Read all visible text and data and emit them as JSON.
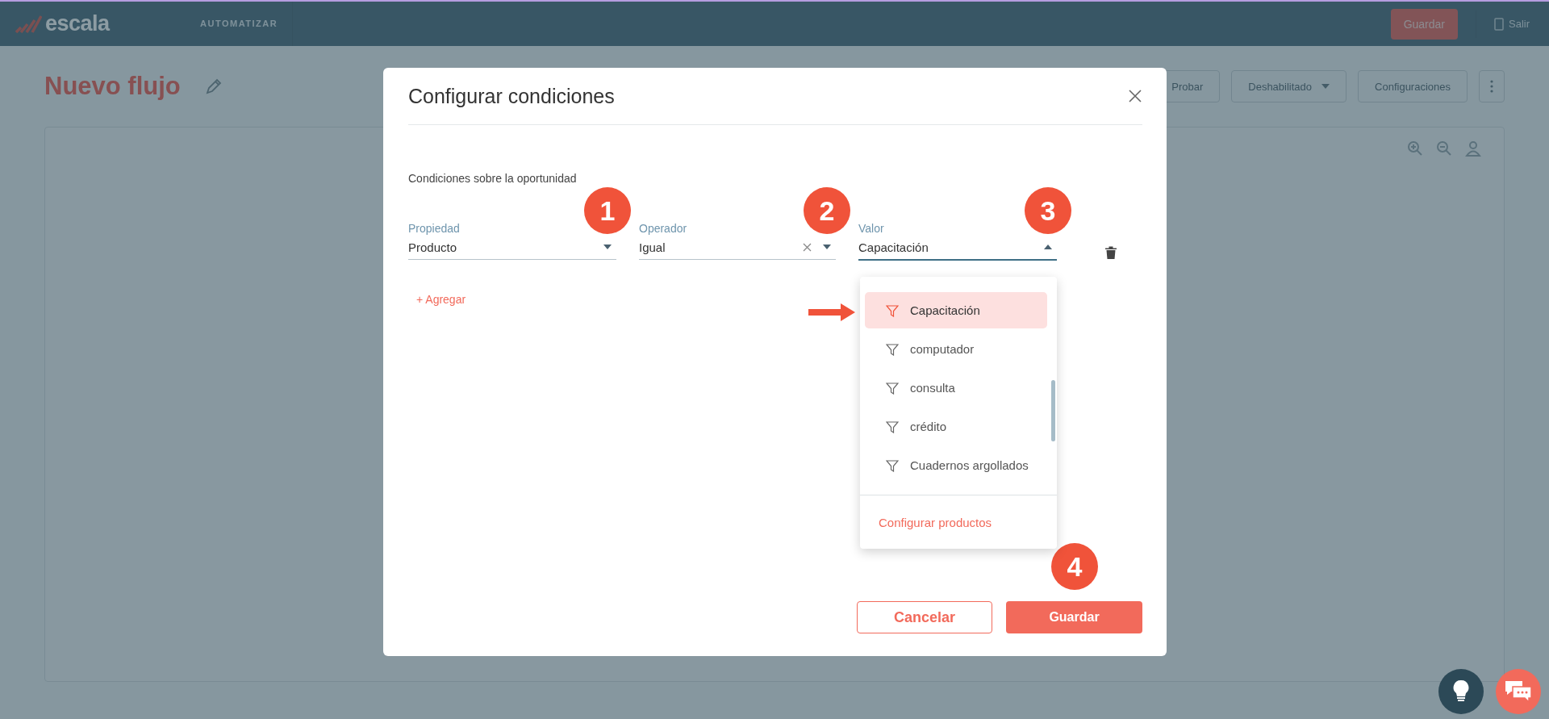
{
  "app_bar": {
    "logo": "escala",
    "section": "AUTOMATIZAR",
    "save_button": "Guardar",
    "exit_link": "Salir"
  },
  "page": {
    "title": "Nuevo flujo",
    "toolbar": [
      {
        "kind": "test",
        "label": "Probar"
      },
      {
        "kind": "dropdown",
        "label": "Deshabilitado"
      },
      {
        "kind": "button",
        "label": "Configuraciones"
      },
      {
        "kind": "more"
      }
    ]
  },
  "modal": {
    "title": "Configurar condiciones",
    "subtitle": "Condiciones sobre la oportunidad",
    "fields": [
      {
        "label": "Propiedad",
        "value": "Producto",
        "clearable": false,
        "open": false,
        "step": "1"
      },
      {
        "label": "Operador",
        "value": "Igual",
        "clearable": true,
        "open": false,
        "step": "2"
      },
      {
        "label": "Valor",
        "value": "Capacitación",
        "clearable": false,
        "open": true,
        "step": "3"
      }
    ],
    "add_link": "+ Agregar",
    "dropdown": {
      "options": [
        {
          "label": "Capacitación",
          "selected": true
        },
        {
          "label": "computador",
          "selected": false
        },
        {
          "label": "consulta",
          "selected": false
        },
        {
          "label": "crédito",
          "selected": false
        },
        {
          "label": "Cuadernos argollados",
          "selected": false
        }
      ],
      "footer_link": "Configurar productos"
    },
    "cancel_button": "Cancelar",
    "save_button": "Guardar",
    "save_step": "4"
  }
}
